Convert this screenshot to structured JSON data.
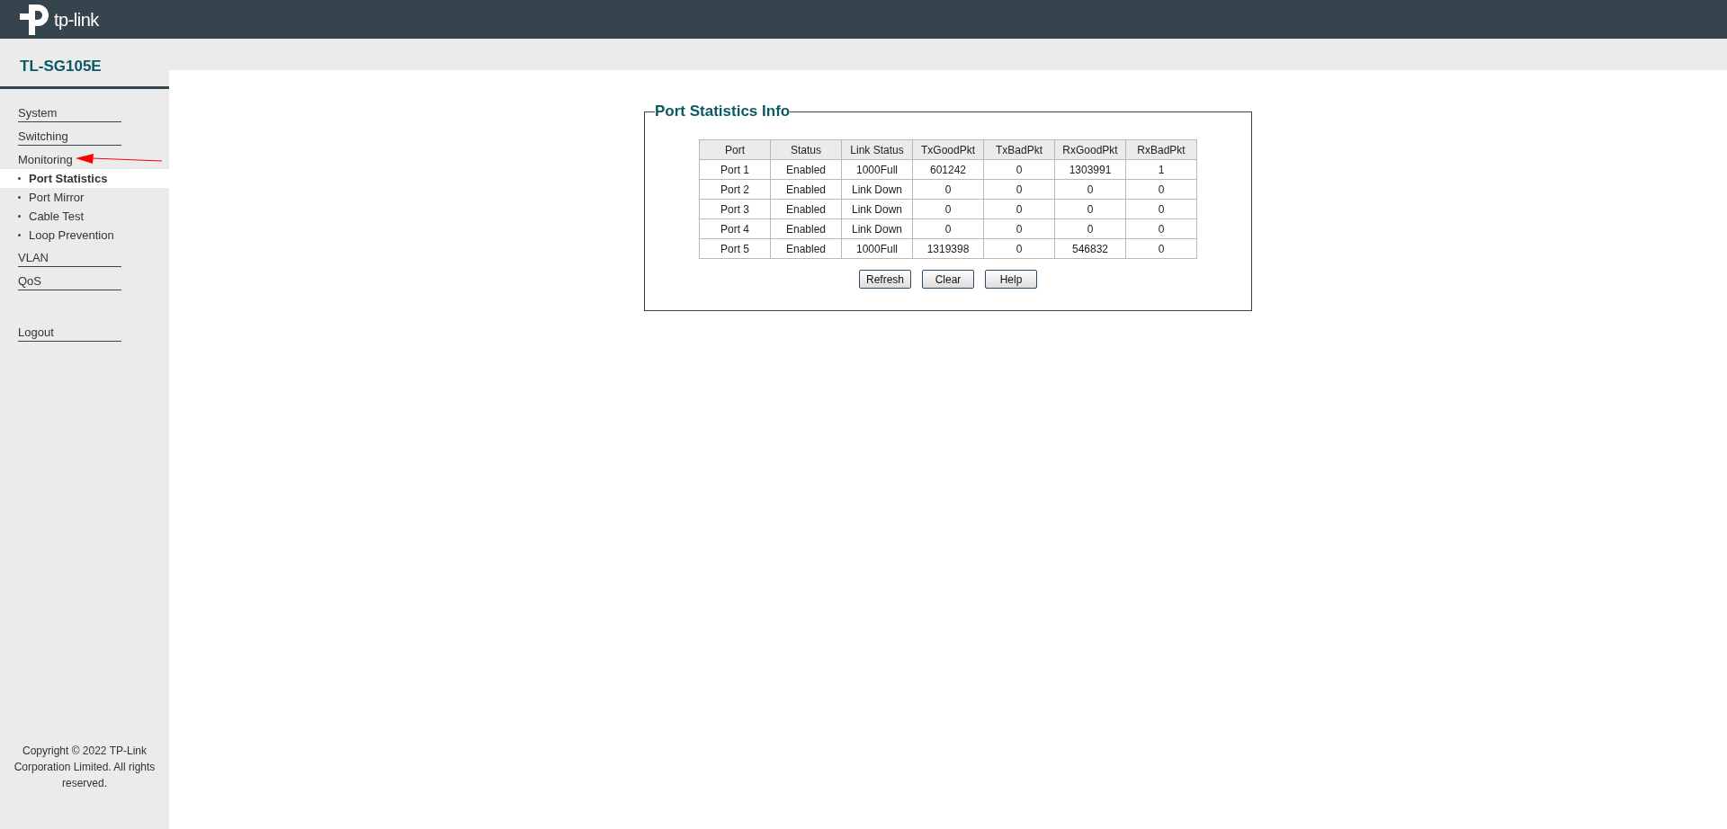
{
  "header": {
    "logo_text": "tp-link"
  },
  "sidebar": {
    "model": "TL-SG105E",
    "items": [
      {
        "label": "System"
      },
      {
        "label": "Switching"
      },
      {
        "label": "Monitoring",
        "children": [
          {
            "label": "Port Statistics",
            "selected": true
          },
          {
            "label": "Port Mirror",
            "selected": false
          },
          {
            "label": "Cable Test",
            "selected": false
          },
          {
            "label": "Loop Prevention",
            "selected": false
          }
        ]
      },
      {
        "label": "VLAN"
      },
      {
        "label": "QoS"
      }
    ],
    "logout": "Logout",
    "copyright": "Copyright © 2022 TP-Link Corporation Limited. All rights reserved."
  },
  "panel": {
    "title": "Port Statistics Info",
    "table": {
      "columns": [
        "Port",
        "Status",
        "Link Status",
        "TxGoodPkt",
        "TxBadPkt",
        "RxGoodPkt",
        "RxBadPkt"
      ],
      "rows": [
        [
          "Port 1",
          "Enabled",
          "1000Full",
          "601242",
          "0",
          "1303991",
          "1"
        ],
        [
          "Port 2",
          "Enabled",
          "Link Down",
          "0",
          "0",
          "0",
          "0"
        ],
        [
          "Port 3",
          "Enabled",
          "Link Down",
          "0",
          "0",
          "0",
          "0"
        ],
        [
          "Port 4",
          "Enabled",
          "Link Down",
          "0",
          "0",
          "0",
          "0"
        ],
        [
          "Port 5",
          "Enabled",
          "1000Full",
          "1319398",
          "0",
          "546832",
          "0"
        ]
      ]
    },
    "buttons": [
      "Refresh",
      "Clear",
      "Help"
    ]
  }
}
